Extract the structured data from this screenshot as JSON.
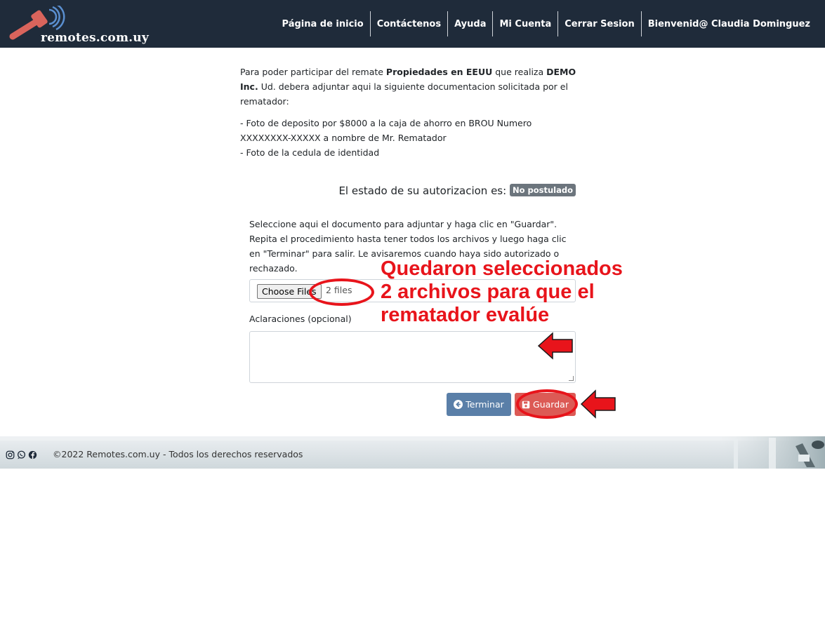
{
  "header": {
    "logo_text": "remotes.com.uy",
    "nav": [
      {
        "label": "Página de inicio"
      },
      {
        "label": "Contáctenos"
      },
      {
        "label": "Ayuda"
      },
      {
        "label": "Mi Cuenta"
      },
      {
        "label": "Cerrar Sesion"
      },
      {
        "label": "Bienvenid@ Claudia Dominguez"
      }
    ]
  },
  "intro": {
    "p1_pre": "Para poder participar del remate ",
    "auction_name": "Propiedades en EEUU",
    "p1_mid": " que realiza ",
    "company": "DEMO Inc.",
    "p1_post": " Ud. debera adjuntar aqui la siguiente documentacion solicitada por el rematador:",
    "req1": "- Foto de deposito por $8000 a la caja de ahorro en BROU Numero XXXXXXXX-XXXXX a nombre de Mr. Rematador",
    "req2": "- Foto de la cedula de identidad"
  },
  "status": {
    "label": "El estado de su autorizacion es:",
    "badge": "No postulado"
  },
  "form": {
    "instructions": "Seleccione aqui el documento para adjuntar y haga clic en \"Guardar\". Repita el procedimiento hasta tener todos los archivos y luego haga clic en \"Terminar\" para salir. Le avisaremos cuando haya sido autorizado o rechazado.",
    "file_button": "Choose Files",
    "file_count": "2 files",
    "aclaraciones_label": "Aclaraciones (opcional)",
    "aclaraciones_value": "",
    "terminar_label": "Terminar",
    "guardar_label": "Guardar"
  },
  "annotation": {
    "line1": "Quedaron seleccionados",
    "line2": "2 archivos para que el",
    "line3": "rematador evalúe"
  },
  "footer": {
    "text": "©2022 Remotes.com.uy - Todos los derechos reservados",
    "icons": [
      "instagram-icon",
      "whatsapp-icon",
      "facebook-icon"
    ]
  },
  "colors": {
    "navbar": "#1f2b3a",
    "badge": "#6c757d",
    "terminar": "#5a7fa8",
    "guardar": "#dc5a55",
    "annotation": "#e8141b"
  }
}
